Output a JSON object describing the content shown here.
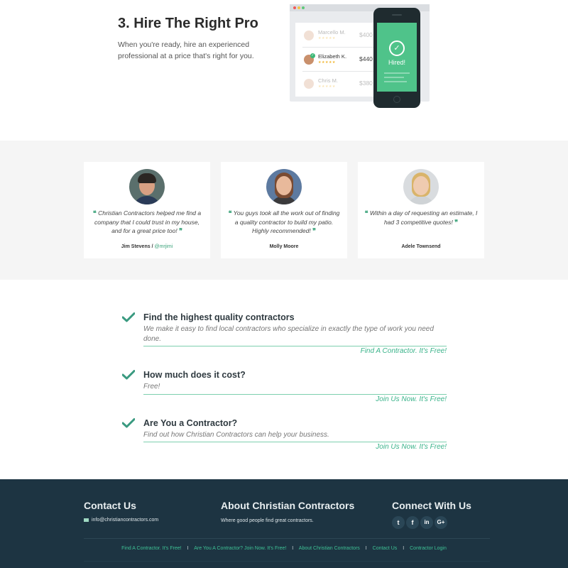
{
  "hero": {
    "title": "3. Hire The Right Pro",
    "description": "When you're ready, hire an experienced professional at a price that's right for you.",
    "mockup": {
      "pros": [
        {
          "name": "Marcello M.",
          "price": "$400",
          "stars": "★★★★★"
        },
        {
          "name": "Elizabeth K.",
          "price": "$440",
          "stars": "★★★★★"
        },
        {
          "name": "Chris M.",
          "price": "$380",
          "stars": "★★★★★"
        }
      ],
      "phone_status": "Hired!"
    }
  },
  "testimonials": [
    {
      "quote": "Christian Contractors helped me find a company that I could trust in my house, and for a great price too!",
      "author": "Jim Stevens",
      "separator": " / ",
      "handle": "@mrjimi"
    },
    {
      "quote": "You guys took all the work out of finding a quality contractor to build my patio. Highly recommended!",
      "author": "Molly Moore"
    },
    {
      "quote": "Within a day of requesting an estimate, I had 3 competitive quotes!",
      "author": "Adele Townsend"
    }
  ],
  "quote_marks": {
    "open": "❝",
    "close": "❞"
  },
  "faq": [
    {
      "title": "Find the highest quality contractors",
      "text": "We make it easy to find local contractors who specialize in exactly the type of work you need done.",
      "cta": "Find A Contractor. It's Free!"
    },
    {
      "title": "How much does it cost?",
      "text": "Free!",
      "cta": "Join Us Now. It's Free!"
    },
    {
      "title": "Are You a Contractor?",
      "text": "Find out how Christian Contractors can help your business.",
      "cta": "Join Us Now. It's Free!"
    }
  ],
  "footer": {
    "contact": {
      "heading": "Contact Us",
      "email": "info@christiancontractors.com",
      "icon": "envelope-icon"
    },
    "about": {
      "heading": "About Christian Contractors",
      "text": "Where good people find great contractors."
    },
    "connect": {
      "heading": "Connect With Us",
      "social": [
        {
          "name": "twitter-icon",
          "glyph": "t"
        },
        {
          "name": "facebook-icon",
          "glyph": "f"
        },
        {
          "name": "linkedin-icon",
          "glyph": "in"
        },
        {
          "name": "google-plus-icon",
          "glyph": "G+"
        }
      ]
    },
    "links": [
      "Find A Contractor. It's Free!",
      "Are You A Contractor? Join Now. It's Free!",
      "About Christian Contractors",
      "Contact Us",
      "Contractor Login"
    ],
    "separator": "I"
  },
  "colors": {
    "accent": "#3ab38a",
    "footer_bg": "#1d3442",
    "testimonial_bg": "#f5f5f5",
    "phone_screen": "#4fc38a"
  }
}
